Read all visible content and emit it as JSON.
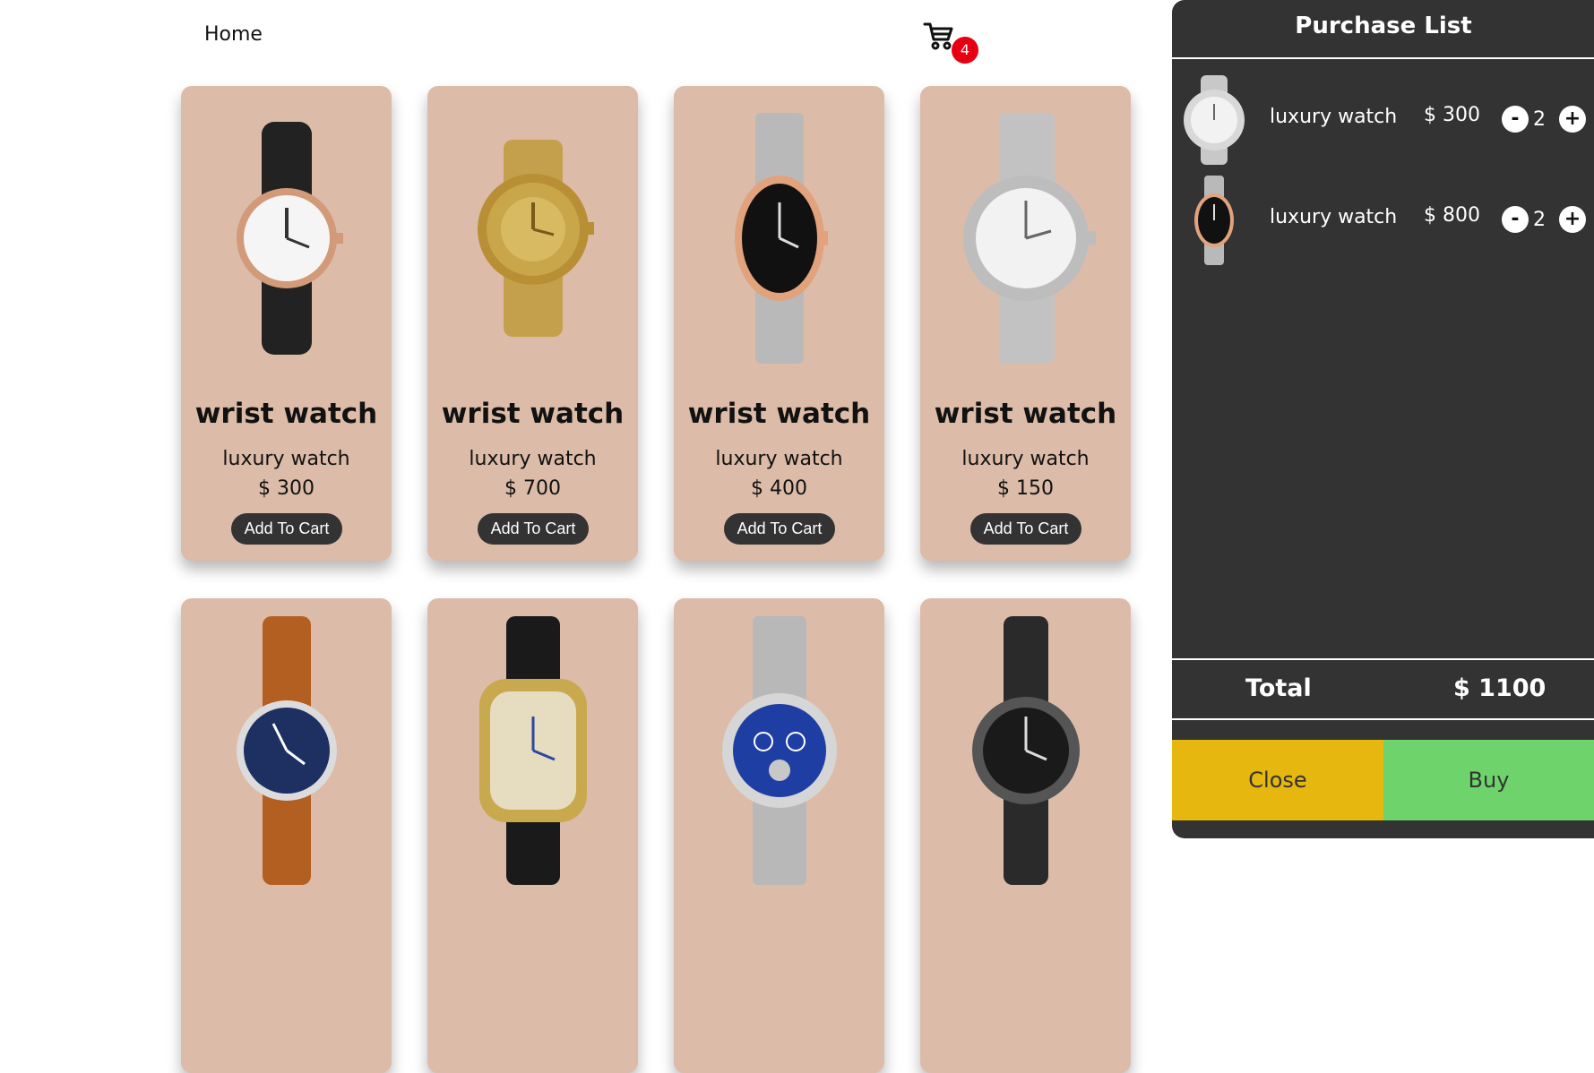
{
  "nav": {
    "home_label": "Home",
    "cart_count": "4"
  },
  "products": [
    {
      "title": "wrist watch",
      "subtitle": "luxury watch",
      "price": "$ 300",
      "button": "Add To Cart",
      "case": "#f4f0ea",
      "dial": "#f5f5f5",
      "strap": "#222222",
      "bezel": "#d39a7a"
    },
    {
      "title": "wrist watch",
      "subtitle": "luxury watch",
      "price": "$ 700",
      "button": "Add To Cart",
      "case": "#d4b25c",
      "dial": "#c9a64a",
      "strap": "#c4a04c",
      "bezel": "#b88f35"
    },
    {
      "title": "wrist watch",
      "subtitle": "luxury watch",
      "price": "$ 400",
      "button": "Add To Cart",
      "case": "#cfcfcf",
      "dial": "#111111",
      "strap": "#b9b9b9",
      "bezel": "#e1a27c"
    },
    {
      "title": "wrist watch",
      "subtitle": "luxury watch",
      "price": "$ 150",
      "button": "Add To Cart",
      "case": "#d8d8d8",
      "dial": "#f2f2f2",
      "strap": "#c2c2c2",
      "bezel": "#bdbdbd"
    },
    {
      "title": "",
      "subtitle": "",
      "price": "",
      "button": "",
      "case": "#c8c8c8",
      "dial": "#1e2f62",
      "strap": "#b35f22",
      "bezel": "#dcdcdc"
    },
    {
      "title": "",
      "subtitle": "",
      "price": "",
      "button": "",
      "case": "#d9bd6a",
      "dial": "#e6dcc0",
      "strap": "#1a1a1a",
      "bezel": "#c9a94d"
    },
    {
      "title": "",
      "subtitle": "",
      "price": "",
      "button": "",
      "case": "#cccccc",
      "dial": "#1f3ea4",
      "strap": "#b8b8b8",
      "bezel": "#d6d6d6"
    },
    {
      "title": "",
      "subtitle": "",
      "price": "",
      "button": "",
      "case": "#3a3a3a",
      "dial": "#1a1a1a",
      "strap": "#2a2a2a",
      "bezel": "#555555"
    }
  ],
  "cart": {
    "title": "Purchase List",
    "items": [
      {
        "name": "luxury watch",
        "price": "$ 300",
        "qty": "2",
        "minus": "-",
        "plus": "+"
      },
      {
        "name": "luxury watch",
        "price": "$ 800",
        "qty": "2",
        "minus": "-",
        "plus": "+"
      }
    ],
    "total_label": "Total",
    "total_value": "$ 1100",
    "close_label": "Close",
    "buy_label": "Buy"
  },
  "colors": {
    "card_bg": "#dcbca8",
    "panel_bg": "#333333",
    "badge": "#e60012",
    "close_btn": "#e6b70f",
    "buy_btn": "#6ed36b"
  }
}
